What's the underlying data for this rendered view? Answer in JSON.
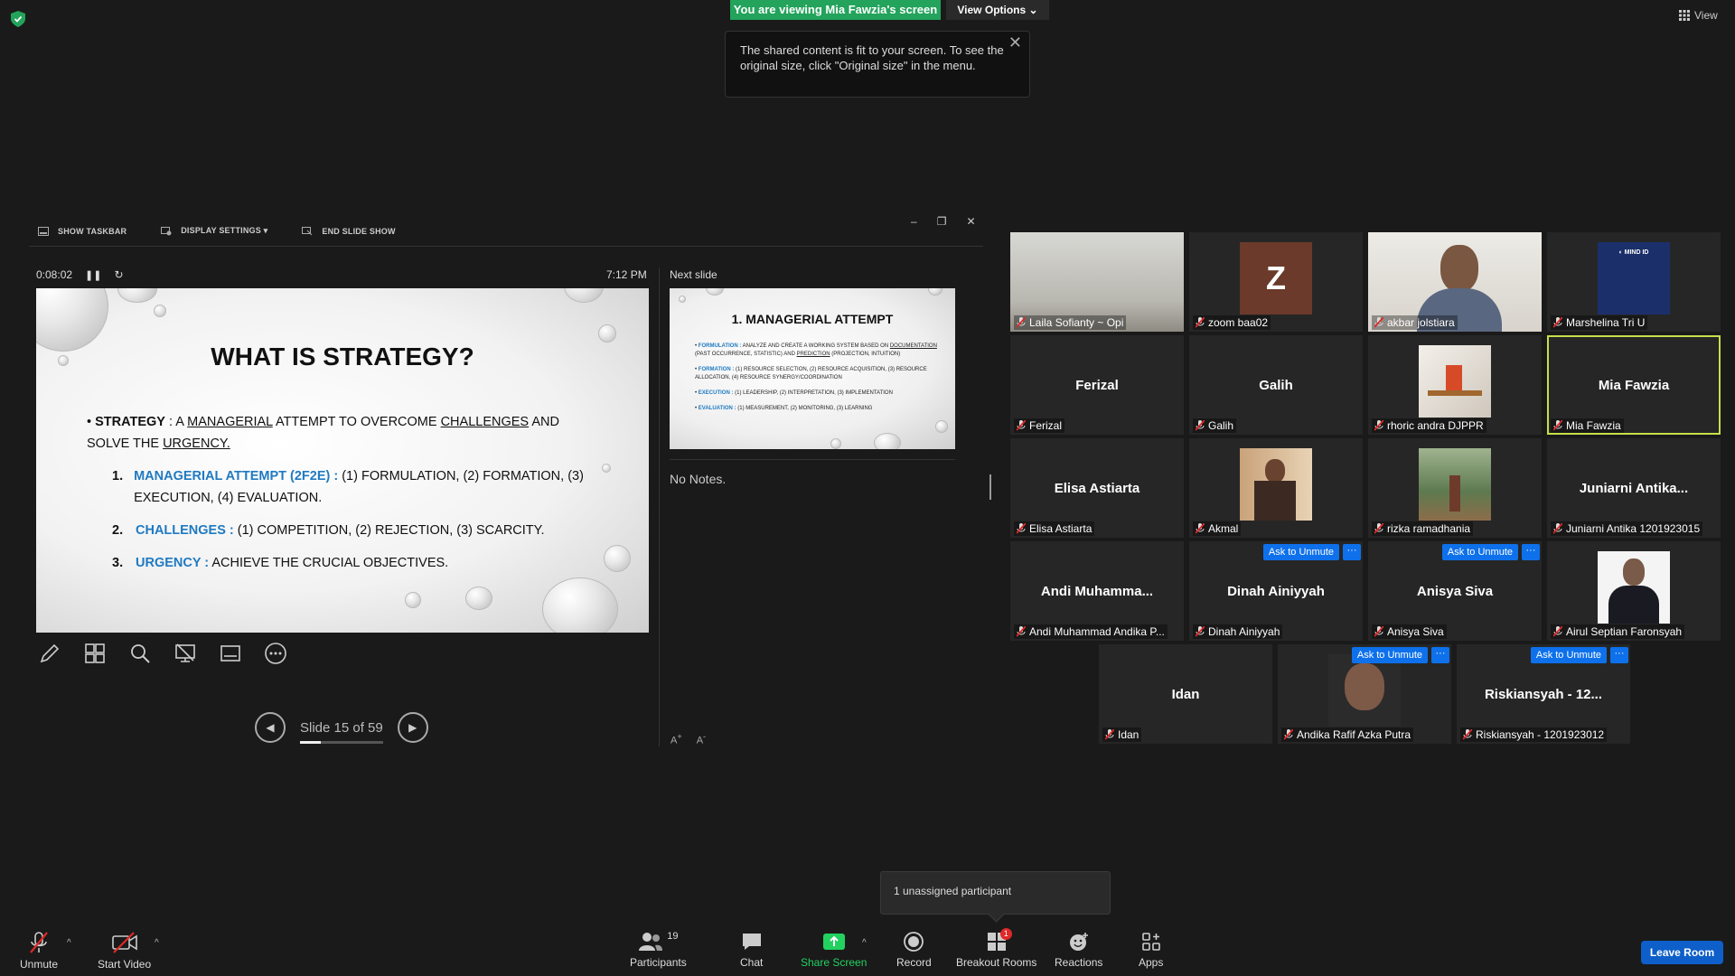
{
  "banner": {
    "viewing_text": "You are viewing Mia Fawzia's screen",
    "view_options_label": "View Options",
    "view_label": "View"
  },
  "tooltip": {
    "text": "The shared content is fit to your screen. To see the original size, click \"Original size\" in the menu."
  },
  "presenter": {
    "toolbar": {
      "show_taskbar": "SHOW TASKBAR",
      "display_settings": "DISPLAY SETTINGS ▾",
      "end_slide_show": "END SLIDE SHOW"
    },
    "elapsed": "0:08:02",
    "clock": "7:12 PM",
    "next_slide_label": "Next slide",
    "notes": "No Notes.",
    "slide_counter": "Slide 15 of 59",
    "slide_progress": 0.25,
    "current_slide": {
      "title": "WHAT IS STRATEGY?",
      "bullet_strategy_label": "STRATEGY",
      "bullet_strategy_sep": " : A ",
      "bullet_word_managerial": "MANAGERIAL",
      "bullet_mid": " ATTEMPT TO OVERCOME ",
      "bullet_word_challenges": "CHALLENGES",
      "bullet_mid2": " AND SOLVE THE ",
      "bullet_word_urgency": "URGENCY.",
      "items": [
        {
          "num": "1.",
          "head": "MANAGERIAL ATTEMPT (2F2E) :",
          "text": " (1) FORMULATION, (2) FORMATION, (3) EXECUTION, (4) EVALUATION."
        },
        {
          "num": "2.",
          "head": "CHALLENGES :",
          "text": " (1) COMPETITION, (2) REJECTION, (3) SCARCITY."
        },
        {
          "num": "3.",
          "head": "URGENCY :",
          "text": " ACHIEVE THE CRUCIAL OBJECTIVES."
        }
      ]
    },
    "next_slide": {
      "title": "1. MANAGERIAL ATTEMPT",
      "items": [
        {
          "head": "FORMULATION :",
          "text": " ANALYZE AND CREATE A WORKING SYSTEM BASED ON ",
          "u1": "DOCUMENTATION",
          "t2": " (PAST OCCURRENCE, STATISTIC) AND ",
          "u2": "PREDICTION",
          "t3": " (PROJECTION, INTUITION)"
        },
        {
          "head": "FORMATION :",
          "text": " (1) RESOURCE SELECTION, (2) RESOURCE ACQUISITION, (3) RESOURCE ALLOCATION, (4) RESOURCE SYNERGY/COORDINATION"
        },
        {
          "head": "EXECUTION :",
          "text": " (1) LEADERSHIP, (2) INTERPRETATION, (3) IMPLEMENTATION"
        },
        {
          "head": "EVALUATION :",
          "text": " (1) MEASUREMENT, (2) MONITORING, (3) LEARNING"
        }
      ]
    }
  },
  "participants_tiles": [
    {
      "label": "Laila Sofianty ~ Opi",
      "center": "",
      "kind": "video-room"
    },
    {
      "label": "zoom baa02",
      "center": "",
      "kind": "letter",
      "letter": "Z"
    },
    {
      "label": "akbar jolstiara",
      "center": "",
      "kind": "video-person"
    },
    {
      "label": "Marshelina Tri U",
      "center": "",
      "kind": "logo",
      "logo_text": "MIND ID"
    },
    {
      "label": "Ferizal",
      "center": "Ferizal",
      "kind": "name"
    },
    {
      "label": "Galih",
      "center": "Galih",
      "kind": "name"
    },
    {
      "label": "rhoric andra DJPPR",
      "center": "",
      "kind": "photo-desk"
    },
    {
      "label": "Mia Fawzia",
      "center": "Mia Fawzia",
      "kind": "name",
      "active": true
    },
    {
      "label": "Elisa Astiarta",
      "center": "Elisa Astiarta",
      "kind": "name"
    },
    {
      "label": "Akmal",
      "center": "",
      "kind": "photo-batik"
    },
    {
      "label": "rizka ramadhania",
      "center": "",
      "kind": "photo-trees"
    },
    {
      "label": "Juniarni Antika 1201923015",
      "center": "Juniarni  Antika...",
      "kind": "name"
    },
    {
      "label": "Andi Muhammad Andika P...",
      "center": "Andi  Muhamma...",
      "kind": "name"
    },
    {
      "label": "Dinah Ainiyyah",
      "center": "Dinah Ainiyyah",
      "kind": "name",
      "ask": true
    },
    {
      "label": "Anisya Siva",
      "center": "Anisya Siva",
      "kind": "name",
      "ask": true
    },
    {
      "label": "Airul Septian Faronsyah",
      "center": "",
      "kind": "photo-suit"
    },
    {
      "label": "Idan",
      "center": "Idan",
      "kind": "name"
    },
    {
      "label": "Andika Rafif Azka Putra",
      "center": "",
      "kind": "photo-smile",
      "ask": true
    },
    {
      "label": "Riskiansyah - 1201923012",
      "center": "Riskiansyah  -  12...",
      "kind": "name",
      "ask": true
    }
  ],
  "ask_to_unmute": "Ask to Unmute",
  "more_label": "···",
  "unassigned_popup": "1 unassigned participant",
  "bottom": {
    "unmute": "Unmute",
    "start_video": "Start Video",
    "participants": "Participants",
    "participants_count": "19",
    "chat": "Chat",
    "share_screen": "Share Screen",
    "record": "Record",
    "breakout_rooms": "Breakout Rooms",
    "breakout_badge": "1",
    "reactions": "Reactions",
    "apps": "Apps",
    "leave_room": "Leave Room"
  },
  "colors": {
    "share_green": "#23a35b",
    "zoom_blue": "#0e71eb",
    "active_speaker": "#c7df4a",
    "mute_red": "#e02828"
  }
}
